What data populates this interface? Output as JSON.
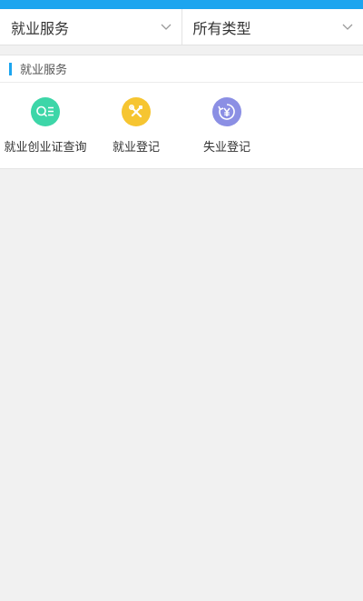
{
  "filters": {
    "category": "就业服务",
    "type": "所有类型"
  },
  "section": {
    "title": "就业服务"
  },
  "services": [
    {
      "label": "就业创业证查询",
      "icon": "certificate-search-icon",
      "color": "#3dd6a8"
    },
    {
      "label": "就业登记",
      "icon": "tools-icon",
      "color": "#f6c531"
    },
    {
      "label": "失业登记",
      "icon": "yuan-refresh-icon",
      "color": "#8b8fe4"
    }
  ],
  "colors": {
    "accent": "#1ca5ef",
    "background": "#f1f1f1"
  }
}
